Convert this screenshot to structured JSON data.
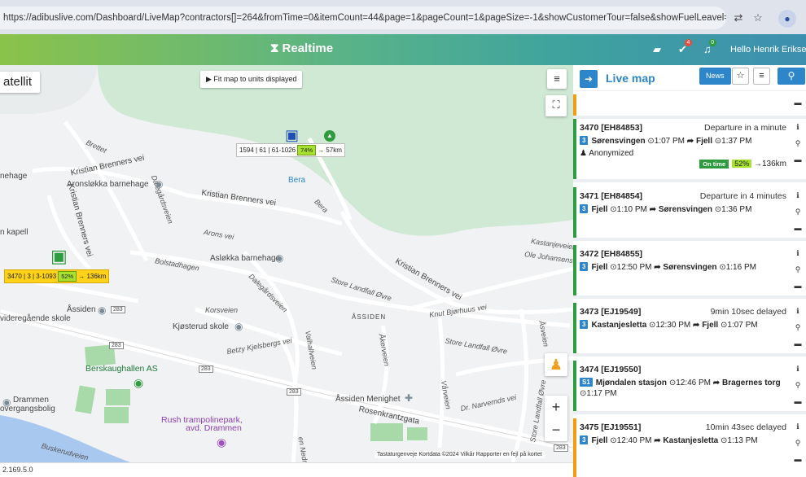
{
  "browser": {
    "url": "https://adibuslive.com/Dashboard/LiveMap?contractors[]=264&fromTime=0&itemCount=44&page=1&pageCount=1&pageSize=-1&showCustomerTour=false&showFuelLeavel=true&showOccu..."
  },
  "header": {
    "title": "Realtime",
    "notif_badge_1": "4",
    "notif_badge_2": "0",
    "greeting": "Hello Henrik Eriksen!"
  },
  "map": {
    "layer_label": "atellit",
    "fit_button": "▶ Fit map to units displayed",
    "labels": {
      "bretten": "Brettet",
      "kb1": "Kristian Brenners vei",
      "kb2": "Kristian Brenners vei",
      "kb3": "Kristian Brenners vei",
      "kb4": "Kristian Brenners vei",
      "aronslokka": "Aronsløkka barnehage",
      "nehage": "nehage",
      "kapell": "n kapell",
      "dalegardsveien": "Dalegårdsveien",
      "arons_vei": "Arons vei",
      "asloekka": "Asløkka barnehage",
      "bolstadhagen": "Bolstadhagen",
      "dalegard2": "Dalegårdsveien",
      "bera": "Bera",
      "bera_road": "Bera",
      "store_landfall": "Store Landfall Øvre",
      "store_landfall2": "Store Landfall Øvre",
      "store_landfall3": "Store Landfall Øvre",
      "kastanjeveien": "Kastanjeveien",
      "ole_johansens": "Ole Johansens ve",
      "knut": "Knut Bjørhuus vei",
      "assiden_upper": "ÅSSIDEN",
      "assiden_vgs_1": "Åssiden",
      "assiden_vgs_2": "videregående skole",
      "korsveien": "Korsveien",
      "kjosterud": "Kjøsterud skole",
      "betzy": "Betzy Kjelsbergs vei",
      "valhall": "Valhallveien",
      "akerveien": "Åkerveien",
      "asveien": "Åsveien",
      "r283a": "283",
      "r283b": "283",
      "r283c": "283",
      "r283d": "283",
      "r283e": "283",
      "berskaug": "Berskaughallen AS",
      "drammen1": "Drammen",
      "drammen2": "overgangsbolig",
      "rush1": "Rush trampolinepark,",
      "rush2": "avd. Drammen",
      "assiden_menighet": "Åssiden Menighet",
      "rosenkrantz": "Rosenkrantzgata",
      "varveien": "Vårveien",
      "narvenes": "Dr. Narvernds vei",
      "buskerud": "Buskerudveien",
      "nedre": "en Nedre",
      "store_landfall_vei": "Store Landfall Øvre"
    },
    "vehicle1": {
      "route": "1594 | 61 | 61-1026",
      "pct": "74%",
      "dist": "→ 57km"
    },
    "vehicle2": {
      "route": "3470 | 3 | 3-1093",
      "pct": "52%",
      "dist": "→ 136km"
    },
    "attribution": "Tastaturgenveje   Kortdata ©2024   Vilkår   Rapporter en fejl på kortet",
    "version": "2.169.5.0"
  },
  "sidebar": {
    "title": "Live map",
    "news": "News",
    "cards": [
      {
        "name": "3470 [EH84853]",
        "status": "Departure in a minute",
        "line": "3",
        "from": "Sørensvingen",
        "from_time": "1:07 PM",
        "to": "Fjell",
        "to_time": "1:37 PM",
        "person": "Anonymized",
        "ontime": "On time",
        "pct": "52%",
        "dist": "→136km"
      },
      {
        "name": "3471 [EH84854]",
        "status": "Departure in 4 minutes",
        "line": "3",
        "from": "Fjell",
        "from_time": "1:10 PM",
        "to": "Sørensvingen",
        "to_time": "1:36 PM"
      },
      {
        "name": "3472 [EH84855]",
        "status": "",
        "line": "3",
        "from": "Fjell",
        "from_time": "12:50 PM",
        "to": "Sørensvingen",
        "to_time": "1:16 PM"
      },
      {
        "name": "3473 [EJ19549]",
        "status": "9min 10sec delayed",
        "line": "3",
        "from": "Kastanjesletta",
        "from_time": "12:30 PM",
        "to": "Fjell",
        "to_time": "1:07 PM"
      },
      {
        "name": "3474 [EJ19550]",
        "status": "",
        "line": "S1",
        "from": "Mjøndalen stasjon",
        "from_time": "12:46 PM",
        "to": "Bragernes torg",
        "to_time": "1:17 PM"
      },
      {
        "name": "3475 [EJ19551]",
        "status": "10min 43sec delayed",
        "line": "3",
        "from": "Fjell",
        "from_time": "12:40 PM",
        "to": "Kastanjesletta",
        "to_time": "1:13 PM"
      }
    ]
  },
  "colors": {
    "accent": "#2d86c9",
    "ontime": "#2e9c3e",
    "warning": "#f39c12"
  }
}
